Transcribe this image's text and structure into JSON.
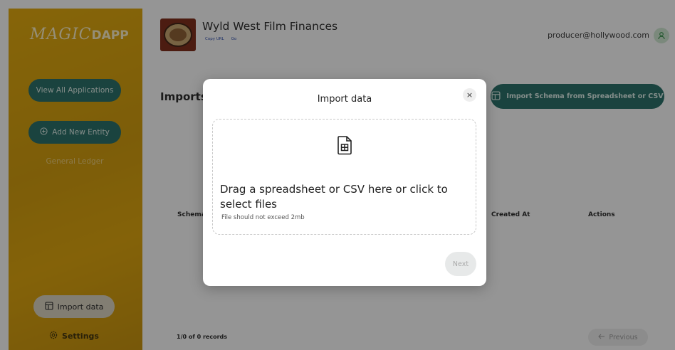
{
  "sidebar": {
    "logo_script": "MAGIC",
    "logo_strong": "DAPP",
    "view_all_label": "View All Applications",
    "add_entity_label": "Add New Entity",
    "general_ledger_label": "General Ledger",
    "import_label": "Import data",
    "settings_label": "Settings"
  },
  "header": {
    "title": "Wyld West Film Finances",
    "copy_url_label": "Copy URL",
    "go_label": "Go",
    "user_email": "producer@hollywood.com"
  },
  "main": {
    "page_title": "Imports",
    "schema_button_label": "Import Schema from Spreadsheet or CSV",
    "table": {
      "columns": [
        "Schema",
        "Created At",
        "Actions"
      ]
    },
    "records_text": "1/0 of 0 records",
    "previous_label": "Previous"
  },
  "modal": {
    "title": "Import data",
    "close_glyph": "×",
    "drop_text": "Drag a spreadsheet or CSV here or click to select files",
    "drop_hint": "File should not exceed 2mb",
    "next_label": "Next"
  },
  "colors": {
    "accent": "#1f6b63",
    "sidebar": "#dfa300",
    "overlay": "rgba(20,20,20,0.45)"
  },
  "icons": [
    "plus-circle-icon",
    "table-import-icon",
    "gear-icon",
    "user-icon",
    "close-icon",
    "spreadsheet-file-icon",
    "arrow-left-icon"
  ]
}
